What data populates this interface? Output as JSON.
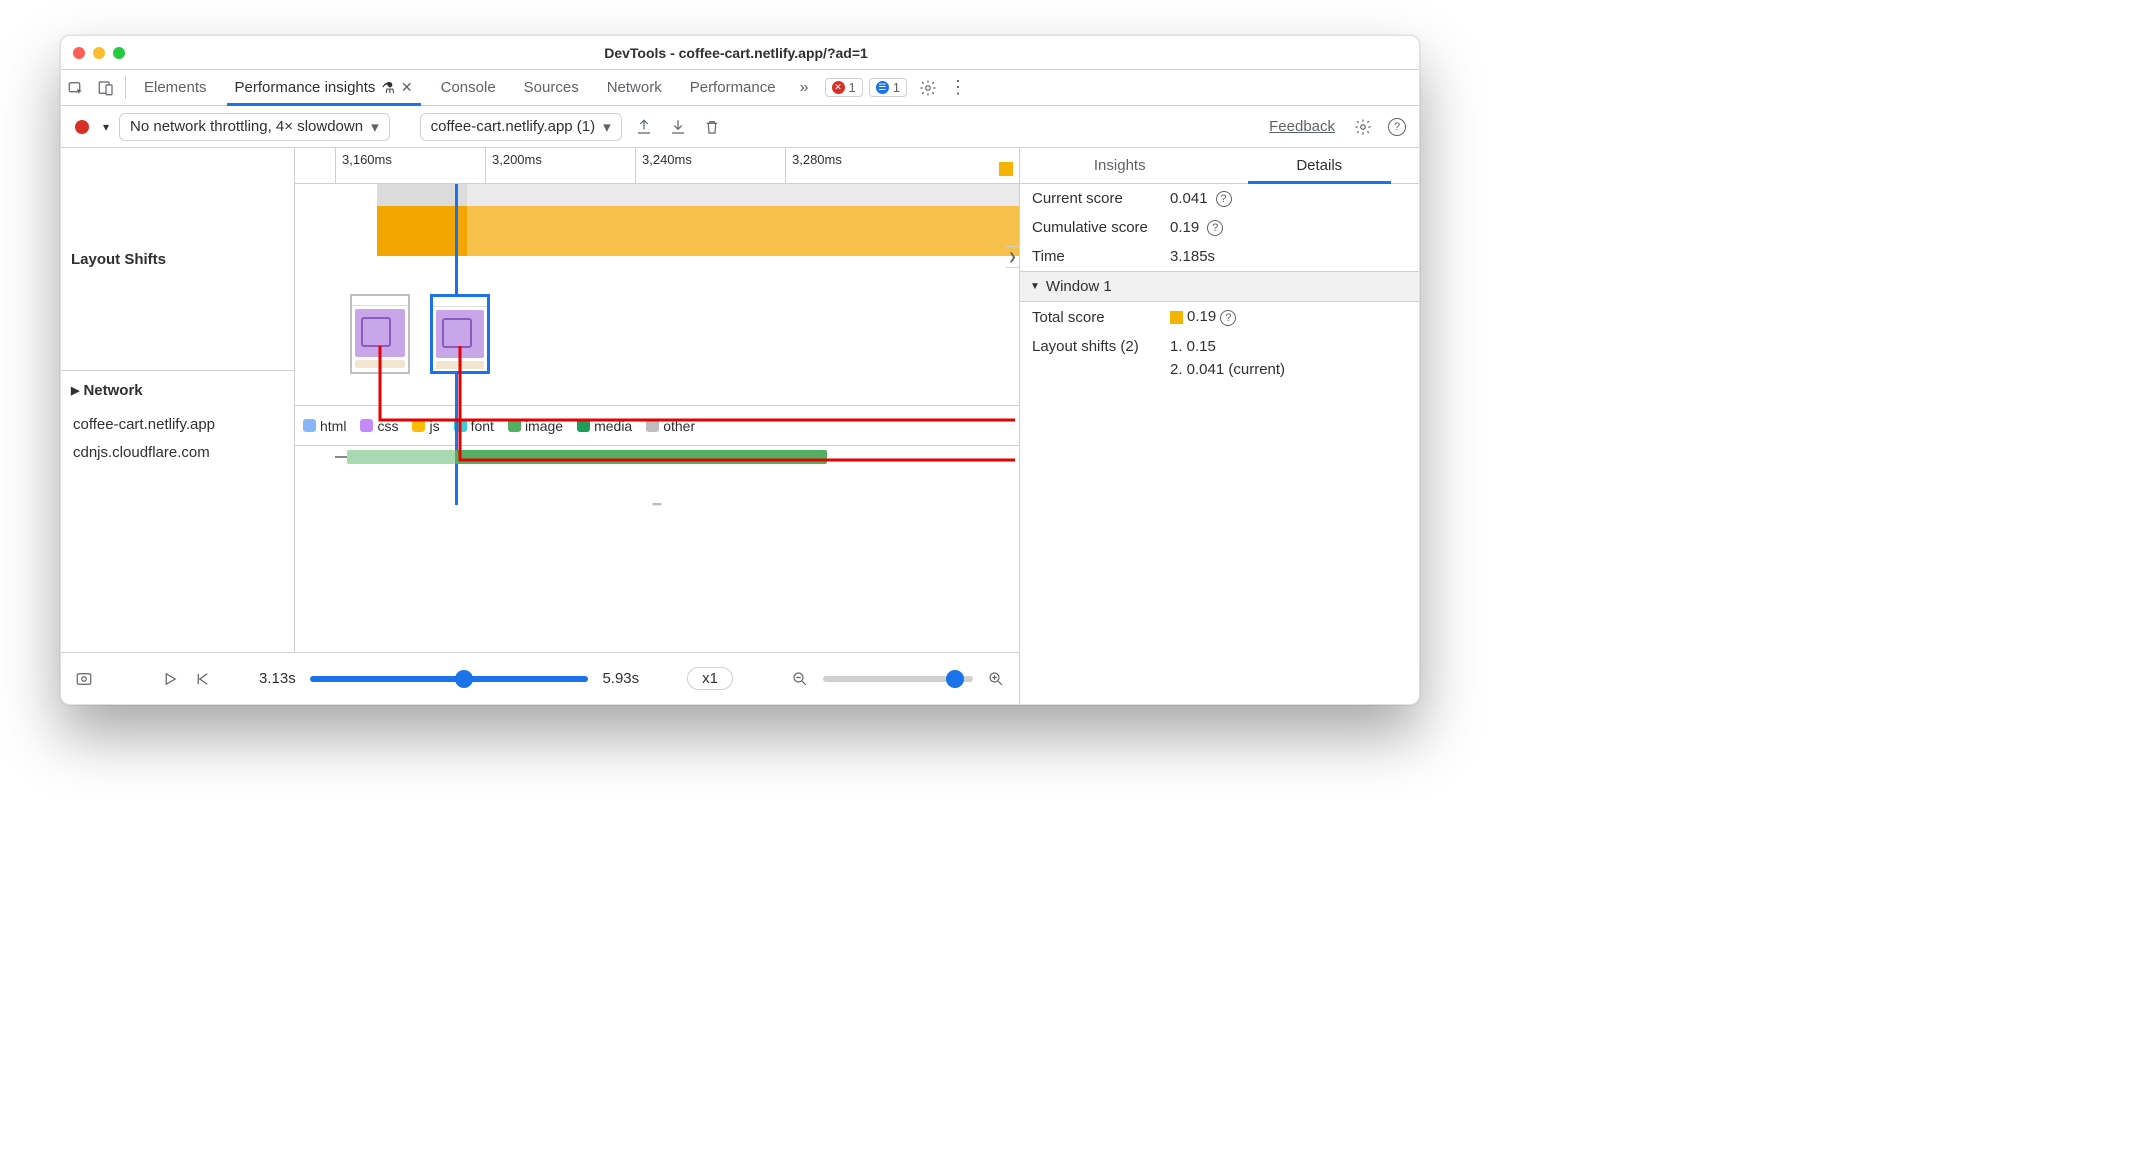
{
  "window": {
    "title": "DevTools - coffee-cart.netlify.app/?ad=1"
  },
  "tabs": {
    "elements": "Elements",
    "perf_insights": "Performance insights",
    "console": "Console",
    "sources": "Sources",
    "network": "Network",
    "performance": "Performance",
    "err_count": "1",
    "msg_count": "1"
  },
  "toolbar": {
    "throttle": "No network throttling, 4× slowdown",
    "recording": "coffee-cart.netlify.app (1)",
    "feedback": "Feedback"
  },
  "ruler": {
    "t0": "3,160ms",
    "t1": "3,200ms",
    "t2": "3,240ms",
    "t3": "3,280ms"
  },
  "rows": {
    "layout_shifts": "Layout Shifts",
    "network": "Network",
    "host1": "coffee-cart.netlify.app",
    "host2": "cdnjs.cloudflare.com"
  },
  "legend": {
    "html": "html",
    "css": "css",
    "js": "js",
    "font": "font",
    "image": "image",
    "media": "media",
    "other": "other"
  },
  "controls": {
    "start": "3.13s",
    "end": "5.93s",
    "speed": "x1"
  },
  "right": {
    "tab_insights": "Insights",
    "tab_details": "Details",
    "current_score_k": "Current score",
    "current_score_v": "0.041",
    "cum_score_k": "Cumulative score",
    "cum_score_v": "0.19",
    "time_k": "Time",
    "time_v": "3.185s",
    "window_hdr": "Window 1",
    "total_score_k": "Total score",
    "total_score_v": "0.19",
    "ls_k": "Layout shifts (2)",
    "ls1": "1. 0.15",
    "ls2": "2. 0.041 (current)"
  }
}
